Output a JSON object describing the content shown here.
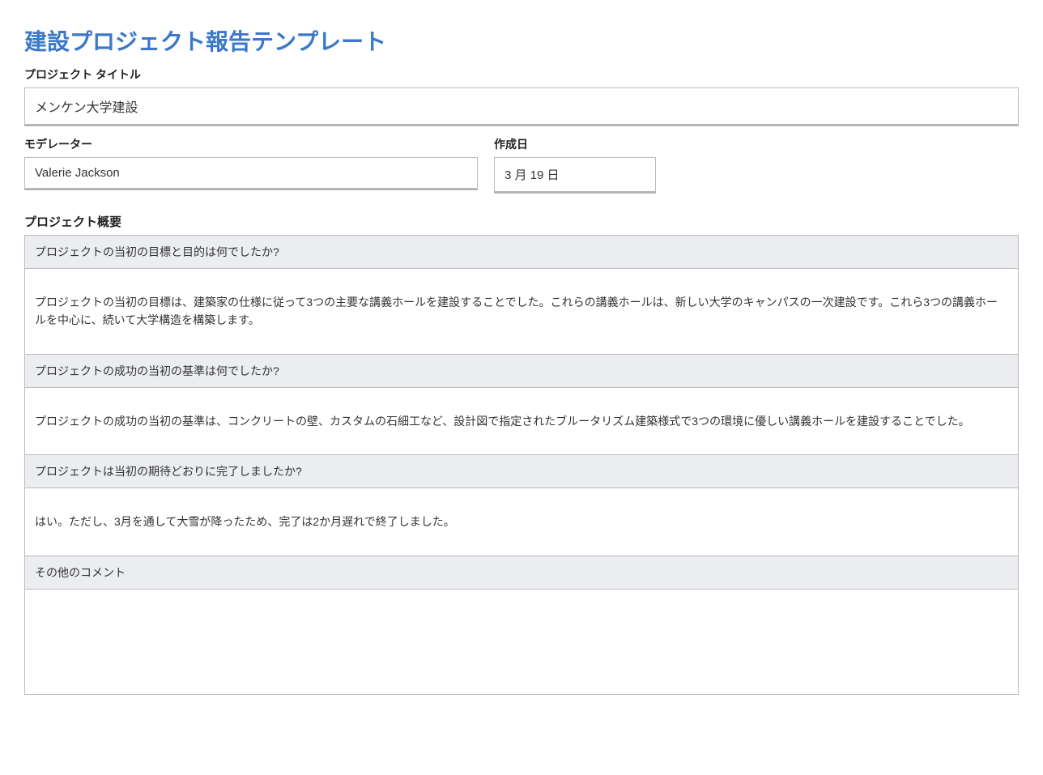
{
  "title": "建設プロジェクト報告テンプレート",
  "project_title": {
    "label": "プロジェクト タイトル",
    "value": "メンケン大学建設"
  },
  "moderator": {
    "label": "モデレーター",
    "value": "Valerie Jackson"
  },
  "creation_date": {
    "label": "作成日",
    "value": "3 月 19 日"
  },
  "overview": {
    "title": "プロジェクト概要",
    "items": [
      {
        "question": "プロジェクトの当初の目標と目的は何でしたか?",
        "answer": "プロジェクトの当初の目標は、建築家の仕様に従って3つの主要な講義ホールを建設することでした。これらの講義ホールは、新しい大学のキャンパスの一次建設です。これら3つの講義ホールを中心に、続いて大学構造を構築します。"
      },
      {
        "question": "プロジェクトの成功の当初の基準は何でしたか?",
        "answer": "プロジェクトの成功の当初の基準は、コンクリートの壁、カスタムの石細工など、設計図で指定されたブルータリズム建築様式で3つの環境に優しい講義ホールを建設することでした。"
      },
      {
        "question": "プロジェクトは当初の期待どおりに完了しましたか?",
        "answer": "はい。ただし、3月を通して大雪が降ったため、完了は2か月遅れで終了しました。"
      },
      {
        "question": "その他のコメント",
        "answer": ""
      }
    ]
  }
}
